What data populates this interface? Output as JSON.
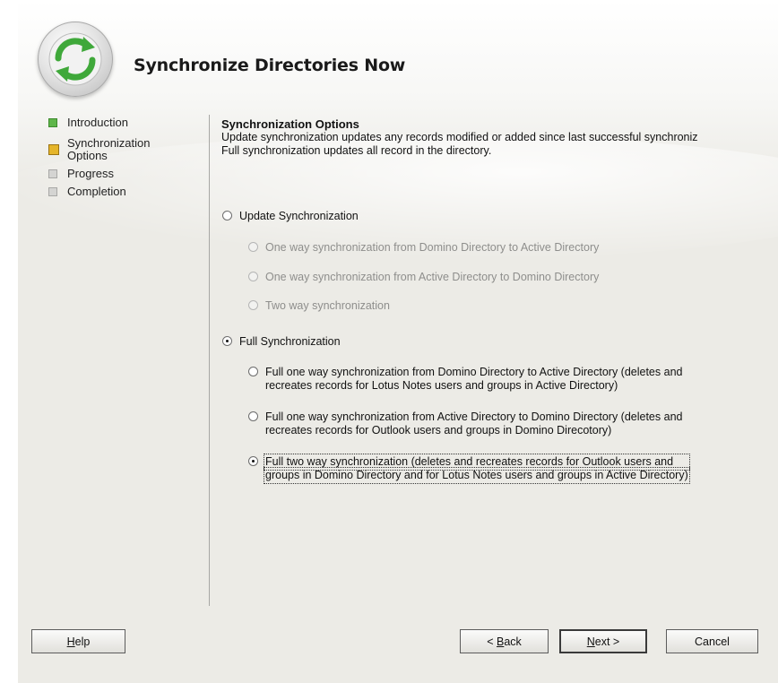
{
  "dialog": {
    "title": "Synchronize Directories Now"
  },
  "nav": {
    "items": [
      {
        "label": "Introduction",
        "state": "done"
      },
      {
        "label": "Synchronization Options",
        "label_line1": "Synchronization",
        "label_line2": "Options",
        "state": "current"
      },
      {
        "label": "Progress",
        "state": "todo"
      },
      {
        "label": "Completion",
        "state": "todo"
      }
    ]
  },
  "content": {
    "section_title": "Synchronization Options",
    "description_line1": "Update synchronization updates any records modified or added since last successful synchroniz",
    "description_line2": "Full synchronization updates all record in the directory.",
    "update_sync": {
      "label": "Update Synchronization",
      "checked": false,
      "options": [
        {
          "label": "One way synchronization from Domino Directory to Active Directory",
          "enabled": false
        },
        {
          "label": "One way synchronization from Active Directory to Domino Directory",
          "enabled": false
        },
        {
          "label": "Two way synchronization",
          "enabled": false
        }
      ]
    },
    "full_sync": {
      "label": "Full Synchronization",
      "checked": true,
      "options": [
        {
          "line1": "Full one way synchronization from Domino Directory to Active Directory (deletes and",
          "line2": "recreates records for Lotus Notes users and groups in Active Directory)",
          "checked": false
        },
        {
          "line1": "Full one way synchronization from Active Directory to Domino Directory (deletes and",
          "line2": "recreates records for Outlook users and groups in Domino Direcotory)",
          "checked": false
        },
        {
          "line1": "Full two way synchronization (deletes and recreates records for Outlook users and",
          "line2": "groups in Domino Directory and for Lotus Notes users and groups in Active Directory)",
          "checked": true
        }
      ]
    }
  },
  "buttons": {
    "help": {
      "accel": "H",
      "rest": "elp"
    },
    "back": {
      "prefix": "< ",
      "accel": "B",
      "rest": "ack"
    },
    "next": {
      "accel": "N",
      "rest": "ext >"
    },
    "cancel": {
      "label": "Cancel"
    }
  },
  "colors": {
    "done": "#5fb64a",
    "current": "#e5b52a",
    "todo": "#d4d4d2",
    "background": "#ecebe6"
  }
}
